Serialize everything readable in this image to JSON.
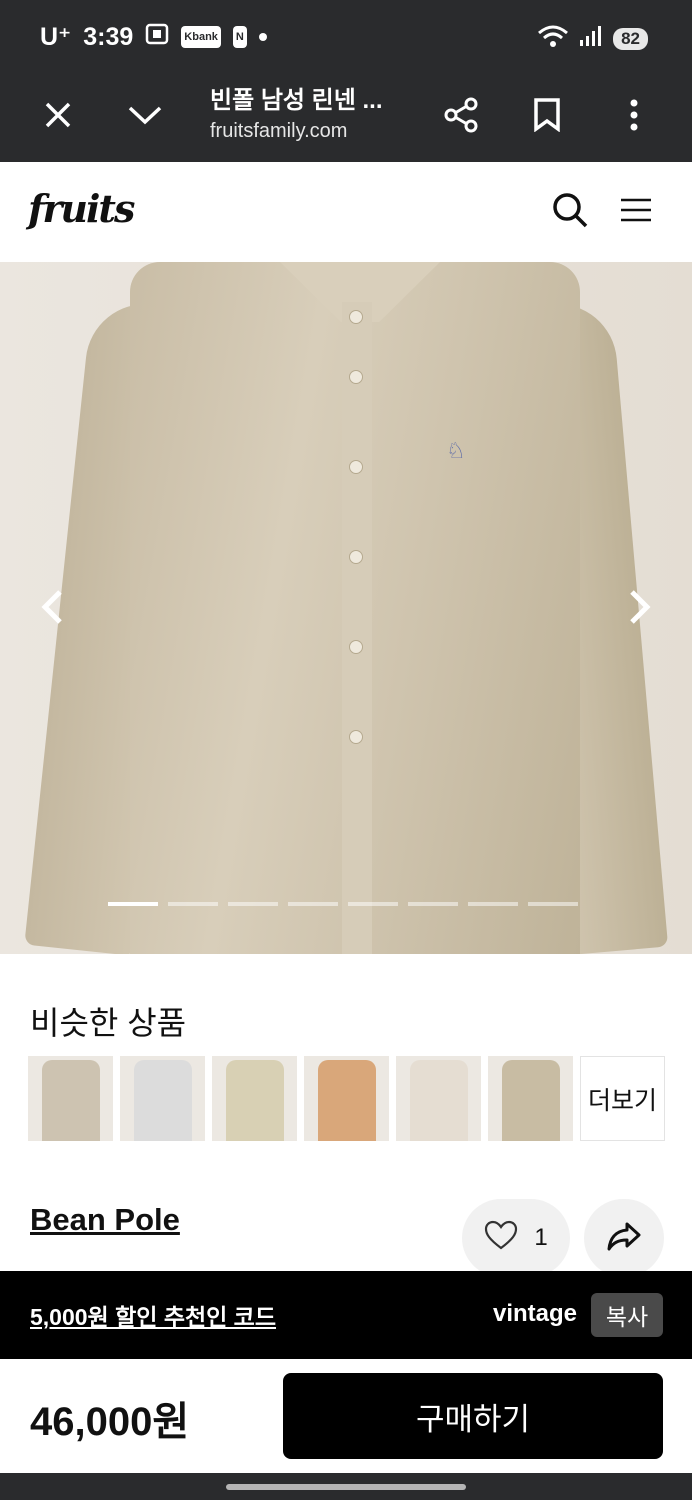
{
  "status": {
    "carrier": "U⁺",
    "time": "3:39",
    "app_badge_1": "Kbank",
    "app_badge_2": "N",
    "battery": "82"
  },
  "browser": {
    "title": "빈폴 남성 린넨 ...",
    "url": "fruitsfamily.com"
  },
  "site": {
    "logo": "fruits"
  },
  "similar": {
    "title": "비슷한 상품",
    "more_label": "더보기",
    "thumb_colors": [
      "#cdc3b1",
      "#dcdcdc",
      "#d8d0b4",
      "#d9a77a",
      "#e5ddd2",
      "#c8bca3"
    ]
  },
  "product": {
    "brand": "Bean Pole",
    "likes": "1",
    "price": "46,000원",
    "buy_label": "구매하기"
  },
  "carousel": {
    "total": 8,
    "active": 0
  },
  "promo": {
    "text": "5,000원 할인 추천인 코드",
    "code": "vintage",
    "copy_label": "복사"
  }
}
